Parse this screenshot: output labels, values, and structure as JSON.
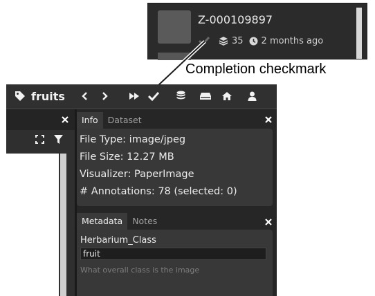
{
  "inset": {
    "item_id": "Z-000109897",
    "annotation_count": "35",
    "timestamp": "2 months ago",
    "icons": [
      "checkmark-icon",
      "layers-icon",
      "clock-icon"
    ]
  },
  "callout": {
    "text": "Completion checkmark"
  },
  "toolbar": {
    "project_name": "fruits",
    "icons": [
      "tag-icon",
      "chevron-left-icon",
      "chevron-right-icon",
      "fast-forward-icon",
      "checkmark-icon",
      "database-icon",
      "drive-icon",
      "home-icon",
      "user-icon"
    ]
  },
  "left_panel": {
    "icons": [
      "close-icon",
      "expand-icon",
      "filter-icon"
    ]
  },
  "info_panel": {
    "tabs": [
      "Info",
      "Dataset"
    ],
    "active_tab": "Info",
    "file_type": "File Type: image/jpeg",
    "file_size": "File Size: 12.27 MB",
    "visualizer": "Visualizer: PaperImage",
    "annotations": "# Annotations: 78 (selected: 0)"
  },
  "metadata_panel": {
    "tabs": [
      "Metadata",
      "Notes"
    ],
    "active_tab": "Metadata",
    "field_label": "Herbarium_Class",
    "field_value": "fruit",
    "field_help": "What overall class is the image"
  },
  "colors": {
    "app_background": "#242424",
    "toolbar_background": "#303030",
    "panel_background": "#383838",
    "text": "#ececec"
  }
}
